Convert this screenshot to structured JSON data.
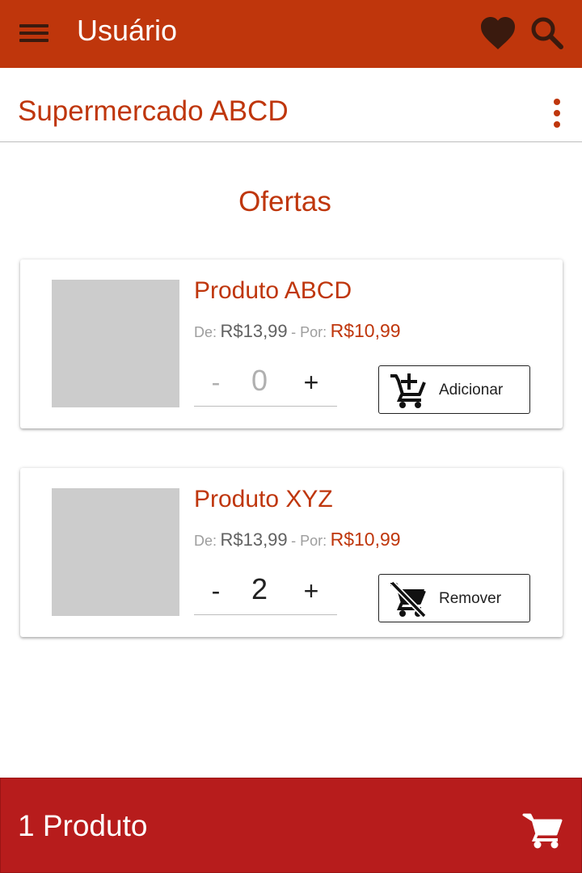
{
  "app_bar": {
    "title": "Usuário",
    "menu_icon": "menu-icon",
    "favorites_icon": "heart-icon",
    "search_icon": "search-icon",
    "color": "#bf360c"
  },
  "store": {
    "name": "Supermercado ABCD",
    "overflow_icon": "more-vert-icon"
  },
  "section": {
    "title": "Ofertas"
  },
  "products": [
    {
      "name": "Produto ABCD",
      "from_label": "De:",
      "from_price": "R$13,99",
      "to_label": "- Por:",
      "to_price": "R$10,99",
      "minus": "-",
      "quantity": "0",
      "plus": "+",
      "action_label": "Adicionar",
      "action_icon": "add-shopping-cart-icon"
    },
    {
      "name": "Produto XYZ",
      "from_label": "De:",
      "from_price": "R$13,99",
      "to_label": "- Por:",
      "to_price": "R$10,99",
      "minus": "-",
      "quantity": "2",
      "plus": "+",
      "action_label": "Remover",
      "action_icon": "remove-shopping-cart-icon"
    }
  ],
  "cart_bar": {
    "count_text": "1 Produto",
    "cart_icon": "shopping-cart-icon",
    "color": "#b71c1c"
  }
}
